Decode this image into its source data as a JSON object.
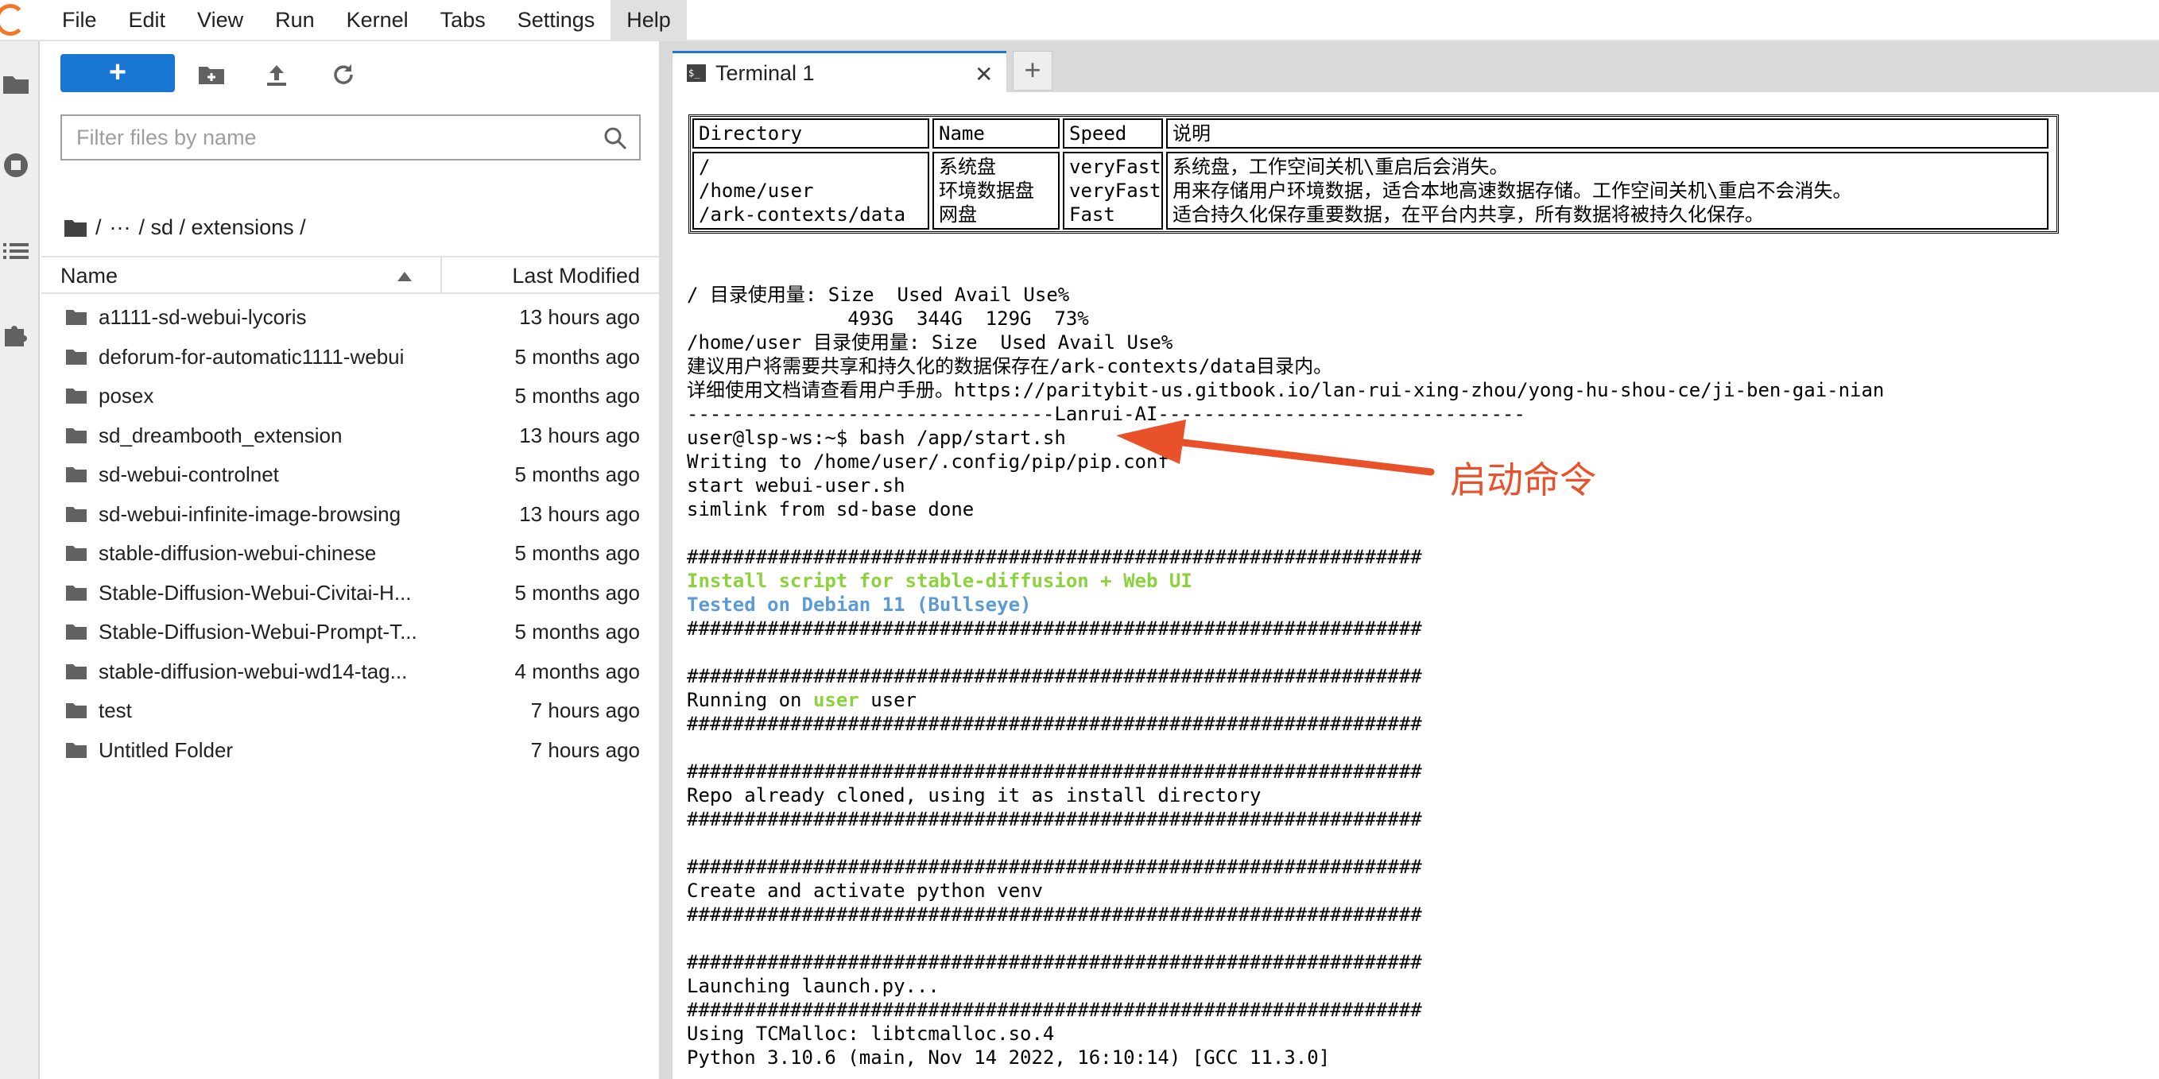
{
  "colors": {
    "accent": "#1976d2",
    "logo": "#f37726",
    "annotation": "#e8512a",
    "term_green": "#8cd23c",
    "term_blue": "#5b9bd5"
  },
  "menubar": {
    "items": [
      "File",
      "Edit",
      "View",
      "Run",
      "Kernel",
      "Tabs",
      "Settings",
      "Help"
    ],
    "active": "Help"
  },
  "sidebar_icons": [
    "folder-icon",
    "running-icon",
    "toc-icon",
    "extension-icon"
  ],
  "filebrowser": {
    "new_label": "+",
    "filter_placeholder": "Filter files by name",
    "breadcrumb": [
      "/",
      "···",
      "/ sd / extensions /"
    ],
    "columns": {
      "name": "Name",
      "modified": "Last Modified"
    },
    "files": [
      {
        "name": "a1111-sd-webui-lycoris",
        "modified": "13 hours ago"
      },
      {
        "name": "deforum-for-automatic1111-webui",
        "modified": "5 months ago"
      },
      {
        "name": "posex",
        "modified": "5 months ago"
      },
      {
        "name": "sd_dreambooth_extension",
        "modified": "13 hours ago"
      },
      {
        "name": "sd-webui-controlnet",
        "modified": "5 months ago"
      },
      {
        "name": "sd-webui-infinite-image-browsing",
        "modified": "13 hours ago"
      },
      {
        "name": "stable-diffusion-webui-chinese",
        "modified": "5 months ago"
      },
      {
        "name": "Stable-Diffusion-Webui-Civitai-H...",
        "modified": "5 months ago"
      },
      {
        "name": "Stable-Diffusion-Webui-Prompt-T...",
        "modified": "5 months ago"
      },
      {
        "name": "stable-diffusion-webui-wd14-tag...",
        "modified": "4 months ago"
      },
      {
        "name": "test",
        "modified": "7 hours ago"
      },
      {
        "name": "Untitled Folder",
        "modified": "7 hours ago"
      }
    ]
  },
  "tabs": [
    {
      "label": "Terminal 1",
      "close": "✕"
    }
  ],
  "newtab_label": "+",
  "terminal": {
    "table_header": [
      "Directory",
      "Name",
      "Speed",
      "说明"
    ],
    "table_body": [
      "/\n/home/user\n/ark-contexts/data",
      "系统盘\n环境数据盘\n网盘",
      "veryFast\nveryFast\nFast",
      "系统盘，工作空间关机\\重启后会消失。\n用来存储用户环境数据，适合本地高速数据存储。工作空间关机\\重启不会消失。\n适合持久化保存重要数据，在平台内共享，所有数据将被持久化保存。"
    ],
    "lines": [
      {
        "text": "/ 目录使用量: Size  Used Avail Use%",
        "style": ""
      },
      {
        "text": "              493G  344G  129G  73%",
        "style": ""
      },
      {
        "text": "/home/user 目录使用量: Size  Used Avail Use%",
        "style": ""
      },
      {
        "text": "建议用户将需要共享和持久化的数据保存在/ark-contexts/data目录内。",
        "style": ""
      },
      {
        "text": "详细使用文档请查看用户手册。https://paritybit-us.gitbook.io/lan-rui-xing-zhou/yong-hu-shou-ce/ji-ben-gai-nian",
        "style": ""
      },
      {
        "text": "--------------------------------Lanrui-AI--------------------------------",
        "style": ""
      },
      {
        "text": "user@lsp-ws:~$ bash /app/start.sh",
        "style": ""
      },
      {
        "text": "Writing to /home/user/.config/pip/pip.conf",
        "style": ""
      },
      {
        "text": "start webui-user.sh",
        "style": ""
      },
      {
        "text": "simlink from sd-base done",
        "style": ""
      },
      {
        "text": "",
        "style": ""
      },
      {
        "text": "################################################################",
        "style": ""
      },
      {
        "text": "Install script for stable-diffusion + Web UI",
        "style": "green"
      },
      {
        "text": "Tested on Debian 11 (Bullseye)",
        "style": "blue"
      },
      {
        "text": "################################################################",
        "style": ""
      },
      {
        "text": "",
        "style": ""
      },
      {
        "text": "################################################################",
        "style": ""
      },
      {
        "text": "Running on ",
        "style": "running",
        "highlight": "user",
        "after": " user"
      },
      {
        "text": "################################################################",
        "style": ""
      },
      {
        "text": "",
        "style": ""
      },
      {
        "text": "################################################################",
        "style": ""
      },
      {
        "text": "Repo already cloned, using it as install directory",
        "style": ""
      },
      {
        "text": "################################################################",
        "style": ""
      },
      {
        "text": "",
        "style": ""
      },
      {
        "text": "################################################################",
        "style": ""
      },
      {
        "text": "Create and activate python venv",
        "style": ""
      },
      {
        "text": "################################################################",
        "style": ""
      },
      {
        "text": "",
        "style": ""
      },
      {
        "text": "################################################################",
        "style": ""
      },
      {
        "text": "Launching launch.py...",
        "style": ""
      },
      {
        "text": "################################################################",
        "style": ""
      },
      {
        "text": "Using TCMalloc: libtcmalloc.so.4",
        "style": ""
      },
      {
        "text": "Python 3.10.6 (main, Nov 14 2022, 16:10:14) [GCC 11.3.0]",
        "style": ""
      }
    ]
  },
  "annotation": {
    "label": "启动命令"
  }
}
